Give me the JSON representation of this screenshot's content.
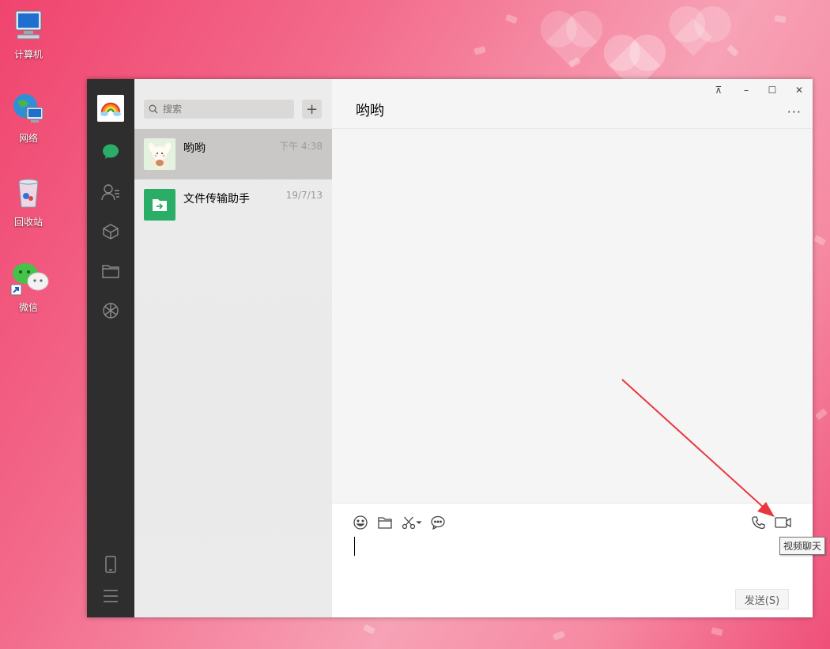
{
  "desktop": {
    "icons": [
      {
        "label": "计算机",
        "icon": "computer-icon"
      },
      {
        "label": "网络",
        "icon": "network-icon"
      },
      {
        "label": "回收站",
        "icon": "recycle-bin-icon"
      },
      {
        "label": "微信",
        "icon": "wechat-icon"
      }
    ]
  },
  "window": {
    "controls": {
      "pin": "⊼",
      "minimize": "–",
      "maximize": "☐",
      "close": "✕"
    }
  },
  "sidebar": {
    "icons": [
      "chat-icon",
      "contacts-icon",
      "collections-icon",
      "files-icon",
      "moments-icon",
      "phone-icon",
      "menu-icon"
    ]
  },
  "chat_list": {
    "search_placeholder": "搜索",
    "add_label": "+",
    "items": [
      {
        "name": "哟哟",
        "time": "下午 4:38",
        "active": true
      },
      {
        "name": "文件传输助手",
        "time": "19/7/13",
        "active": false
      }
    ]
  },
  "conversation": {
    "title": "哟哟",
    "more_label": "···",
    "send_label": "发送(S)",
    "tooltip": "视频聊天"
  },
  "colors": {
    "accent": "#2aae67",
    "nav_bg": "#2e2e2e",
    "annotation_arrow": "#e8383d"
  }
}
